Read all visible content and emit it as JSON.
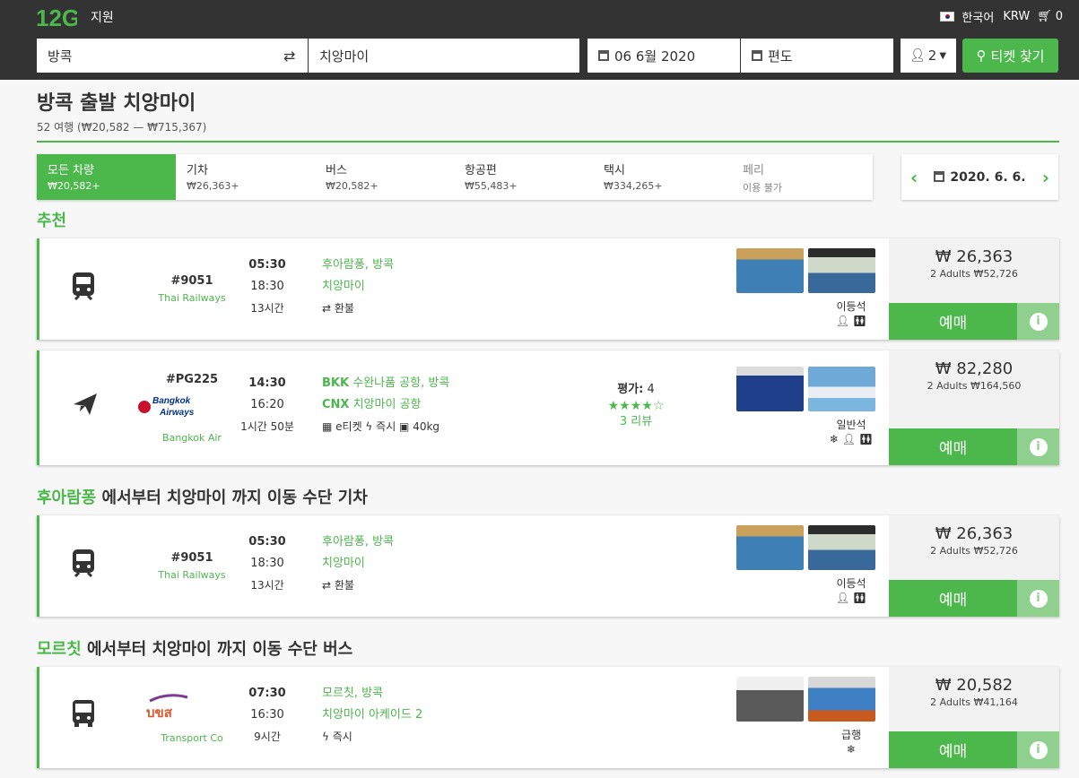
{
  "header": {
    "logo": "12Go",
    "support": "지원",
    "language": "한국어",
    "currency": "KRW",
    "cart_count": "0"
  },
  "search": {
    "from": "방콕",
    "to": "치앙마이",
    "date": "06 6월 2020",
    "return": "편도",
    "passengers": "2",
    "find_label": "티켓 찾기"
  },
  "page": {
    "title": "방콕 출발 치앙마이",
    "subtitle": "52 여행 (₩20,582 — ₩715,367)"
  },
  "tabs": [
    {
      "label": "모든 차량",
      "price": "₩20,582+"
    },
    {
      "label": "기차",
      "price": "₩26,363+"
    },
    {
      "label": "버스",
      "price": "₩20,582+"
    },
    {
      "label": "항공편",
      "price": "₩55,483+"
    },
    {
      "label": "택시",
      "price": "₩334,265+"
    },
    {
      "label": "페리",
      "price": "이용 불가"
    }
  ],
  "date_nav": {
    "date": "2020. 6. 6."
  },
  "sections": {
    "recommended": "추천",
    "train_hl": "후아람퐁",
    "train_rest": " 에서부터 치앙마이 까지 이동 수단 기차",
    "bus_hl": "모르칫",
    "bus_rest": " 에서부터 치앙마이 까지 이동 수단 버스"
  },
  "results": [
    {
      "num": "#9051",
      "operator": "Thai Railways",
      "dep": "05:30",
      "arr": "18:30",
      "dur": "13시간",
      "from": "후아람퐁, 방콕",
      "to": "치앙마이",
      "feat": "⇄ 환불",
      "cls": "이등석",
      "price": "₩ 26,363",
      "adults": "2 Adults ₩52,726",
      "book": "예매",
      "icon": "train-icon"
    },
    {
      "num": "#PG225",
      "operator": "Bangkok Air",
      "logo_text": "Bangkok Airways",
      "dep": "14:30",
      "arr": "16:20",
      "dur": "1시간 50분",
      "from_code": "BKK",
      "from": "수완나품 공항, 방콕",
      "to_code": "CNX",
      "to": "치앙마이 공항",
      "feat": "▦ e티켓  ϟ 즉시  ▣ 40kg",
      "rating_label": "평가:",
      "rating": "4",
      "reviews": "3 리뷰",
      "cls": "일반석",
      "price": "₩ 82,280",
      "adults": "2 Adults ₩164,560",
      "book": "예매",
      "icon": "plane-icon"
    },
    {
      "num": "#9051",
      "operator": "Thai Railways",
      "dep": "05:30",
      "arr": "18:30",
      "dur": "13시간",
      "from": "후아람퐁, 방콕",
      "to": "치앙마이",
      "feat": "⇄ 환불",
      "cls": "이등석",
      "price": "₩ 26,363",
      "adults": "2 Adults ₩52,726",
      "book": "예매",
      "icon": "train-icon"
    },
    {
      "num": "",
      "operator": "Transport Co",
      "logo_text": "บขส",
      "dep": "07:30",
      "arr": "16:30",
      "dur": "9시간",
      "from": "모르칫, 방콕",
      "to": "치앙마이 아케이드 2",
      "feat": "ϟ 즉시",
      "cls": "급행",
      "price": "₩ 20,582",
      "adults": "2 Adults ₩41,164",
      "book": "예매",
      "icon": "bus-icon"
    }
  ],
  "colors": {
    "accent": "#4cb84c",
    "header": "#333333"
  }
}
